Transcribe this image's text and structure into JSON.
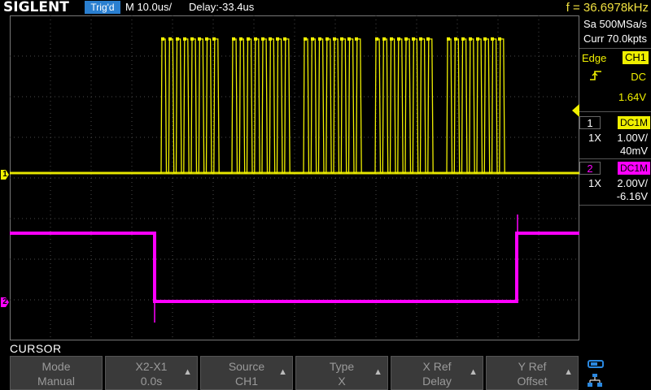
{
  "header": {
    "logo": "SIGLENT",
    "trigger_status": "Trig'd",
    "timebase": "M 10.0us/",
    "delay": "Delay:-33.4us",
    "frequency": "f = 36.6978kHz"
  },
  "acquisition": {
    "sample_rate": "Sa 500MSa/s",
    "memory_depth": "Curr 70.0kpts"
  },
  "trigger": {
    "mode": "Edge",
    "source": "CH1",
    "slope_icon": "rising-edge-icon",
    "coupling": "DC",
    "level": "1.64V"
  },
  "channels": [
    {
      "number": "1",
      "coupling": "DC1M",
      "probe": "1X",
      "scale": "1.00V/",
      "offset": "40mV",
      "color": "#f0f000"
    },
    {
      "number": "2",
      "coupling": "DC1M",
      "probe": "1X",
      "scale": "2.00V/",
      "offset": "-6.16V",
      "color": "#ff00ff"
    }
  ],
  "screen_markers": {
    "ch1": "1",
    "ch2": "2"
  },
  "menu": {
    "title": "CURSOR",
    "softkeys": [
      {
        "label": "Mode",
        "value": "Manual",
        "arrow": ""
      },
      {
        "label": "X2-X1",
        "value": "0.0s",
        "arrow": "▲"
      },
      {
        "label": "Source",
        "value": "CH1",
        "arrow": "▲"
      },
      {
        "label": "Type",
        "value": "X",
        "arrow": "▲"
      },
      {
        "label": "X Ref",
        "value": "Delay",
        "arrow": "▲"
      },
      {
        "label": "Y Ref",
        "value": "Offset",
        "arrow": "▲"
      }
    ]
  },
  "status_icons": [
    "toggle-icon",
    "network-icon"
  ],
  "colors": {
    "ch1": "#f0f000",
    "ch2": "#ff00ff",
    "accent": "#2a7fd0",
    "grid": "#4a4a4a"
  }
}
